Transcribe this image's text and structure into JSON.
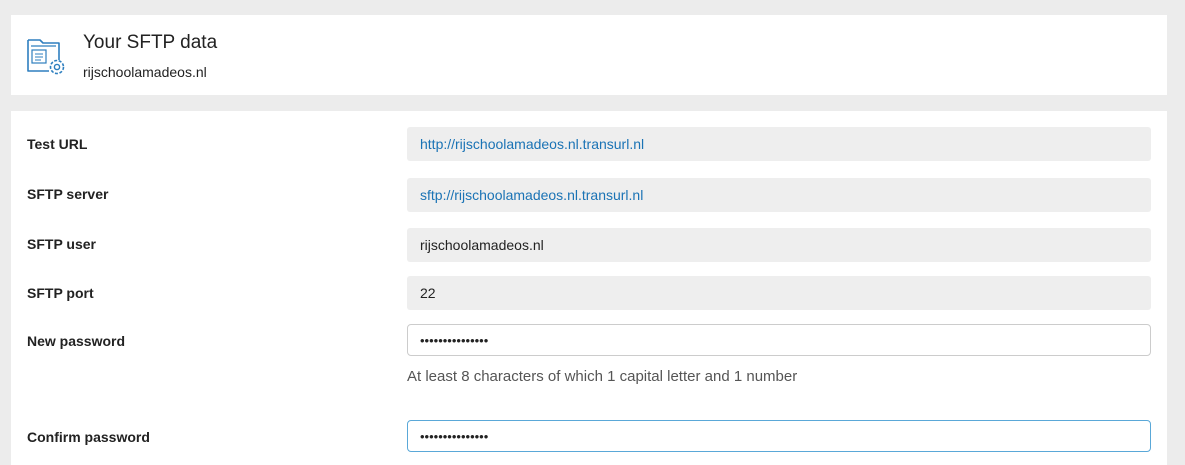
{
  "header": {
    "title": "Your SFTP data",
    "subtitle": "rijschoolamadeos.nl",
    "icon": "folder-settings-icon"
  },
  "form": {
    "test_url": {
      "label": "Test URL",
      "value": "http://rijschoolamadeos.nl.transurl.nl"
    },
    "sftp_server": {
      "label": "SFTP server",
      "value": "sftp://rijschoolamadeos.nl.transurl.nl"
    },
    "sftp_user": {
      "label": "SFTP user",
      "value": "rijschoolamadeos.nl"
    },
    "sftp_port": {
      "label": "SFTP port",
      "value": "22"
    },
    "new_password": {
      "label": "New password",
      "value": "passwordvalue12",
      "hint": "At least 8 characters of which 1 capital letter and 1 number"
    },
    "confirm_password": {
      "label": "Confirm password",
      "value": "passwordvalue12"
    }
  },
  "colors": {
    "link": "#1a73b5",
    "icon": "#2e7fbf",
    "focus_border": "#5aa8d8",
    "page_bg": "#ececec"
  }
}
